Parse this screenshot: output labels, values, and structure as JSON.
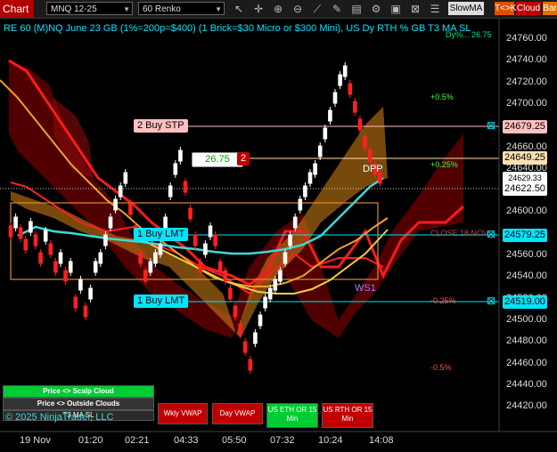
{
  "toolbar": {
    "title": "Chart",
    "instrument": "MNQ 12-25",
    "period": "60 Renko",
    "slow_ma": "SlowMA",
    "tk": "T<>K",
    "cloud": "Cloud",
    "bar": "Bar"
  },
  "chart": {
    "header": "RE 60 (M)NQ June 23 GB (1%=200p=$400) (1 Brick=$30 Micro or $300 Mini), US Dy RTH % GB T3 MA SL",
    "header_overlay": "Dy%... 26.75",
    "y_labels": [
      "24760.00",
      "24740.00",
      "24720.00",
      "24700.00",
      "24680.00",
      "24660.00",
      "24640.00",
      "24620.00",
      "24600.00",
      "24580.00",
      "24560.00",
      "24540.00",
      "24520.00",
      "24500.00",
      "24480.00",
      "24460.00",
      "24440.00",
      "24420.00"
    ],
    "x_labels": [
      "19 Nov",
      "01:20",
      "02:21",
      "04:33",
      "05:50",
      "07:32",
      "10:24",
      "14:08"
    ],
    "price_labels": {
      "buy_stp": "24679.25",
      "last": "24649.25",
      "current": "24622.50",
      "lmt1": "24579.25",
      "lmt2": "24519.00",
      "partial": "24629.33"
    },
    "orders": {
      "buy_stp": "2 Buy STP",
      "lmt1": "1 Buy LMT",
      "lmt2": "1 Buy LMT",
      "pnl": "26.75",
      "qty": "2"
    },
    "annotations": {
      "pct_pos_05": "+0.5%",
      "pct_pos_025": "+0.25%",
      "pct_neg_025": "-0.25%",
      "pct_neg_05": "-0.5%",
      "close": "CLOSE 18 NOV",
      "dpp": "DPP",
      "ws1": "WS1",
      "copyright": "© 2025 NinjaTrader, LLC"
    }
  },
  "buttons": {
    "scalp": "Price <> Scalp Cloud",
    "outside": "Price <> Outside Clouds",
    "t3": "T3 MA SL",
    "wkly_vwap": "Wkly VWAP",
    "day_vwap": "Day VWAP",
    "us_eth": "US ETH OR 15 Min",
    "us_rth": "US RTH OR 15 Min"
  },
  "colors": {
    "toolbar_red": "#b00000",
    "buy_stp_bg": "#ffc0c0",
    "lmt_bg": "#00e5ff",
    "current_bg": "#ffffff",
    "last_bg": "#ffe0b0",
    "cloud_red": "#6b0000",
    "cloud_orange": "#c87a14",
    "ma_teal": "#3dd8d8",
    "ma_yellow": "#f0d040",
    "green_btn": "#00cc33",
    "red_btn": "#c00000"
  },
  "icons": [
    "chevron-down-icon",
    "pointer-icon",
    "crosshair-icon",
    "zoom-in-icon",
    "zoom-out-icon",
    "draw-icon",
    "drawing-tools-icon",
    "properties-icon",
    "strategy-icon",
    "lock-icon",
    "close-icon"
  ]
}
